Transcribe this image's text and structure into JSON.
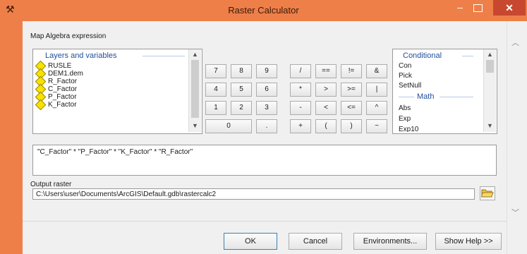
{
  "window": {
    "title": "Raster Calculator",
    "minimize_glyph": "–",
    "close_glyph": "✕"
  },
  "expression_label": "Map Algebra expression",
  "layers_panel": {
    "header": "Layers and variables",
    "items": [
      "RUSLE",
      "DEM1.dem",
      "R_Factor",
      "C_Factor",
      "P_Factor",
      "K_Factor"
    ]
  },
  "keypad": {
    "rows": [
      [
        "7",
        "8",
        "9",
        "/",
        "==",
        "!=",
        "&"
      ],
      [
        "4",
        "5",
        "6",
        "*",
        ">",
        ">=",
        "|"
      ],
      [
        "1",
        "2",
        "3",
        "-",
        "<",
        "<=",
        "^"
      ],
      [
        "0",
        ".",
        "+",
        "(",
        ")",
        "~"
      ]
    ]
  },
  "functions_panel": {
    "group1": "Conditional",
    "group1_items": [
      "Con",
      "Pick",
      "SetNull"
    ],
    "group2": "Math",
    "group2_items": [
      "Abs",
      "Exp",
      "Exp10"
    ]
  },
  "expression": "\"C_Factor\" * \"P_Factor\" * \"K_Factor\" * \"R_Factor\"",
  "output": {
    "label": "Output raster",
    "value": "C:\\Users\\user\\Documents\\ArcGIS\\Default.gdb\\rastercalc2"
  },
  "buttons": {
    "ok": "OK",
    "cancel": "Cancel",
    "environments": "Environments...",
    "help": "Show Help >>"
  },
  "icons": {
    "tool": "hammer-icon",
    "browse": "folder-open-icon",
    "layer": "raster-layer-diamond-icon"
  },
  "colors": {
    "titlebar": "#ee7f49",
    "close_button": "#c7482f",
    "list_header": "#1f4e9a",
    "layer_icon": "#f7e200"
  }
}
